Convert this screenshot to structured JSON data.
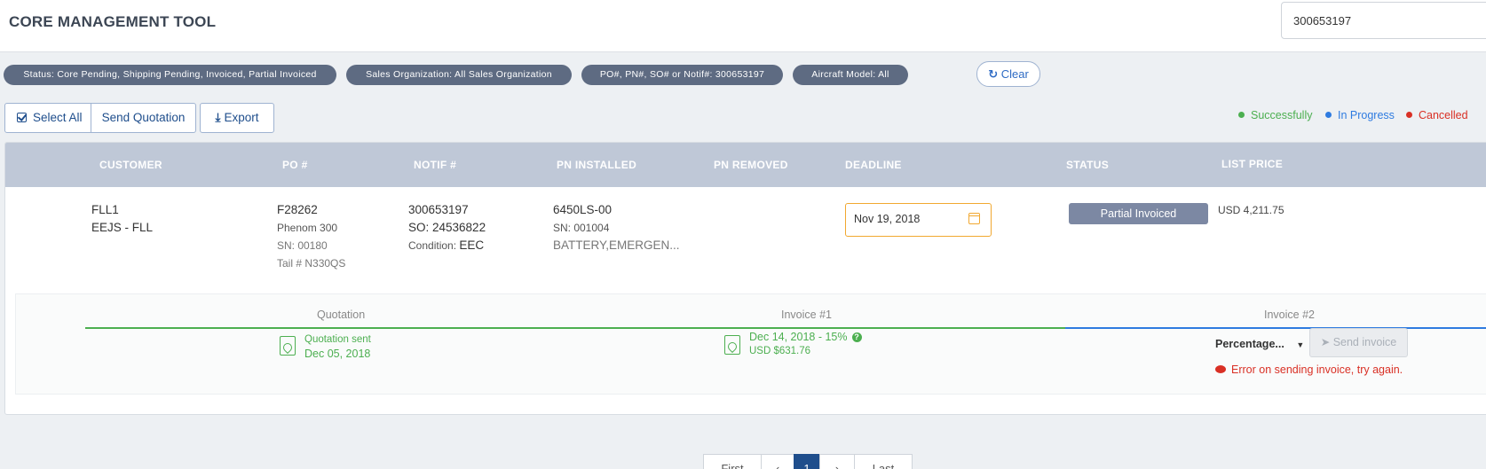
{
  "header": {
    "title": "CORE MANAGEMENT TOOL",
    "search_value": "300653197"
  },
  "filters": [
    "Status: Core Pending, Shipping Pending, Invoiced, Partial Invoiced",
    "Sales Organization: All Sales Organization",
    "PO#, PN#, SO# or Notif#: 300653197",
    "Aircraft Model: All"
  ],
  "clear_label": "Clear",
  "toolbar": {
    "select_all": "Select All",
    "send_quotation": "Send Quotation",
    "export": "Export"
  },
  "legend": [
    {
      "label": "Successfully",
      "color": "#4caf50"
    },
    {
      "label": "In Progress",
      "color": "#2e7be0"
    },
    {
      "label": "Cancelled",
      "color": "#d93025"
    }
  ],
  "table": {
    "columns": [
      "CUSTOMER",
      "PO #",
      "NOTIF #",
      "PN INSTALLED",
      "PN REMOVED",
      "DEADLINE",
      "STATUS",
      "LIST PRICE"
    ],
    "row": {
      "customer": {
        "code": "FLL1",
        "name": "EEJS - FLL"
      },
      "po": {
        "number": "F28262",
        "model": "Phenom 300",
        "sn": "SN: 00180",
        "tail": "Tail # N330QS"
      },
      "notif": {
        "number": "300653197",
        "so": "SO: 24536822",
        "condition_label": "Condition:",
        "condition_value": "EEC"
      },
      "pn_installed": {
        "pn": "6450LS-00",
        "sn": "SN: 001004",
        "desc": "BATTERY,EMERGEN..."
      },
      "deadline": "Nov 19, 2018",
      "status": "Partial Invoiced",
      "list_price": "USD 4,211.75"
    }
  },
  "timeline": {
    "stages": [
      {
        "title": "Quotation",
        "line1": "Quotation sent",
        "line2": "Dec 05, 2018"
      },
      {
        "title": "Invoice #1",
        "line1": "Dec 14, 2018 - 15%",
        "line2": "USD $631.76"
      },
      {
        "title": "Invoice #2"
      }
    ],
    "invoice2": {
      "select_value": "Percentage...",
      "send_label": "Send invoice",
      "error": "Error on sending invoice, try again."
    }
  },
  "pagination": [
    "First",
    "‹",
    "1",
    "›",
    "Last"
  ]
}
